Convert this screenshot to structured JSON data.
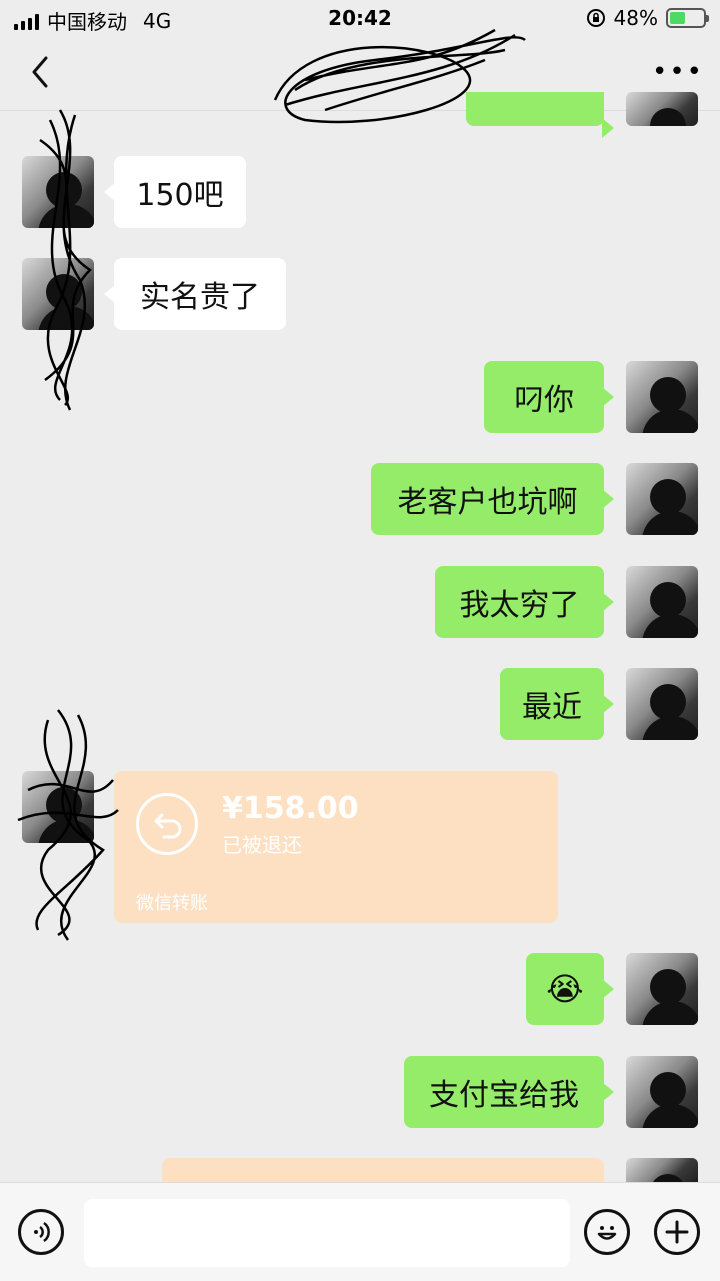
{
  "status_bar": {
    "carrier": "中国移动",
    "network": "4G",
    "time": "20:42",
    "battery_percent": "48%",
    "battery_level": 0.48,
    "battery_color": "#4cd964"
  },
  "nav": {
    "back_icon": "chevron-left-icon",
    "more_icon": "ellipsis-icon",
    "more_label": "•••"
  },
  "messages": [
    {
      "side": "left",
      "type": "text",
      "text": "150吧"
    },
    {
      "side": "left",
      "type": "text",
      "text": "实名贵了"
    },
    {
      "side": "right",
      "type": "text",
      "text": "叼你"
    },
    {
      "side": "right",
      "type": "text",
      "text": "老客户也坑啊"
    },
    {
      "side": "right",
      "type": "text",
      "text": "我太穷了"
    },
    {
      "side": "right",
      "type": "text",
      "text": "最近"
    },
    {
      "side": "left",
      "type": "transfer",
      "amount": "¥158.00",
      "status": "已被退还",
      "label": "微信转账"
    },
    {
      "side": "right",
      "type": "emoji",
      "text": "😭"
    },
    {
      "side": "right",
      "type": "text",
      "text": "支付宝给我"
    },
    {
      "side": "right",
      "type": "transfer",
      "text": ""
    }
  ],
  "input_bar": {
    "voice_icon": "voice-icon",
    "emoji_icon": "emoji-face-icon",
    "plus_icon": "plus-icon",
    "input_value": ""
  },
  "colors": {
    "background": "#ededed",
    "green_bubble": "#95ec69",
    "white_bubble": "#ffffff",
    "transfer_card": "#fde0c2"
  }
}
